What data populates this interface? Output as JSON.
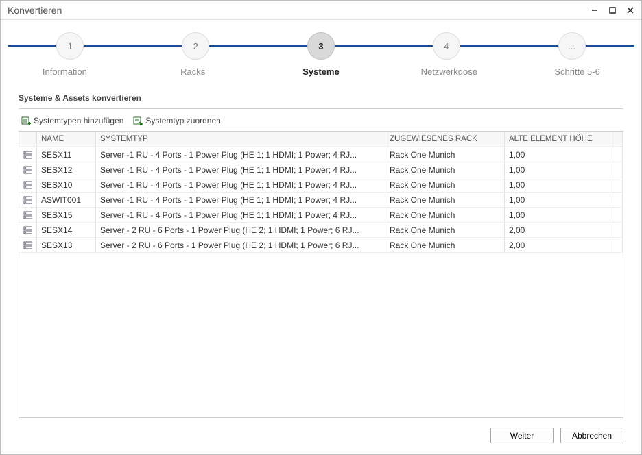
{
  "window": {
    "title": "Konvertieren"
  },
  "steps": [
    {
      "num": "1",
      "label": "Information"
    },
    {
      "num": "2",
      "label": "Racks"
    },
    {
      "num": "3",
      "label": "Systeme",
      "active": true
    },
    {
      "num": "4",
      "label": "Netzwerkdose"
    },
    {
      "num": "...",
      "label": "Schritte 5-6"
    }
  ],
  "section_title": "Systeme & Assets konvertieren",
  "toolbar": {
    "add_types": "Systemtypen hinzufügen",
    "assign_type": "Systemtyp zuordnen"
  },
  "columns": {
    "name": "NAME",
    "systemtype": "SYSTEMTYP",
    "assigned_rack": "ZUGEWIESENES RACK",
    "old_height": "ALTE ELEMENT HÖHE"
  },
  "rows": [
    {
      "name": "SESX11",
      "systemtype": "Server  -1 RU - 4 Ports - 1 Power Plug (HE 1; 1 HDMI; 1 Power; 4 RJ...",
      "rack": "Rack One Munich",
      "height": "1,00"
    },
    {
      "name": "SESX12",
      "systemtype": "Server  -1 RU - 4 Ports - 1 Power Plug (HE 1; 1 HDMI; 1 Power; 4 RJ...",
      "rack": "Rack One Munich",
      "height": "1,00"
    },
    {
      "name": "SESX10",
      "systemtype": "Server  -1 RU - 4 Ports - 1 Power Plug (HE 1; 1 HDMI; 1 Power; 4 RJ...",
      "rack": "Rack One Munich",
      "height": "1,00"
    },
    {
      "name": "ASWIT001",
      "systemtype": "Server  -1 RU - 4 Ports - 1 Power Plug (HE 1; 1 HDMI; 1 Power; 4 RJ...",
      "rack": "Rack One Munich",
      "height": "1,00"
    },
    {
      "name": "SESX15",
      "systemtype": "Server  -1 RU - 4 Ports - 1 Power Plug (HE 1; 1 HDMI; 1 Power; 4 RJ...",
      "rack": "Rack One Munich",
      "height": "1,00"
    },
    {
      "name": "SESX14",
      "systemtype": "Server - 2 RU - 6 Ports - 1 Power Plug (HE 2; 1 HDMI; 1 Power; 6 RJ...",
      "rack": "Rack One Munich",
      "height": "2,00"
    },
    {
      "name": "SESX13",
      "systemtype": "Server - 2 RU - 6 Ports - 1 Power Plug (HE 2; 1 HDMI; 1 Power; 6 RJ...",
      "rack": "Rack One Munich",
      "height": "2,00"
    }
  ],
  "buttons": {
    "next": "Weiter",
    "cancel": "Abbrechen"
  }
}
